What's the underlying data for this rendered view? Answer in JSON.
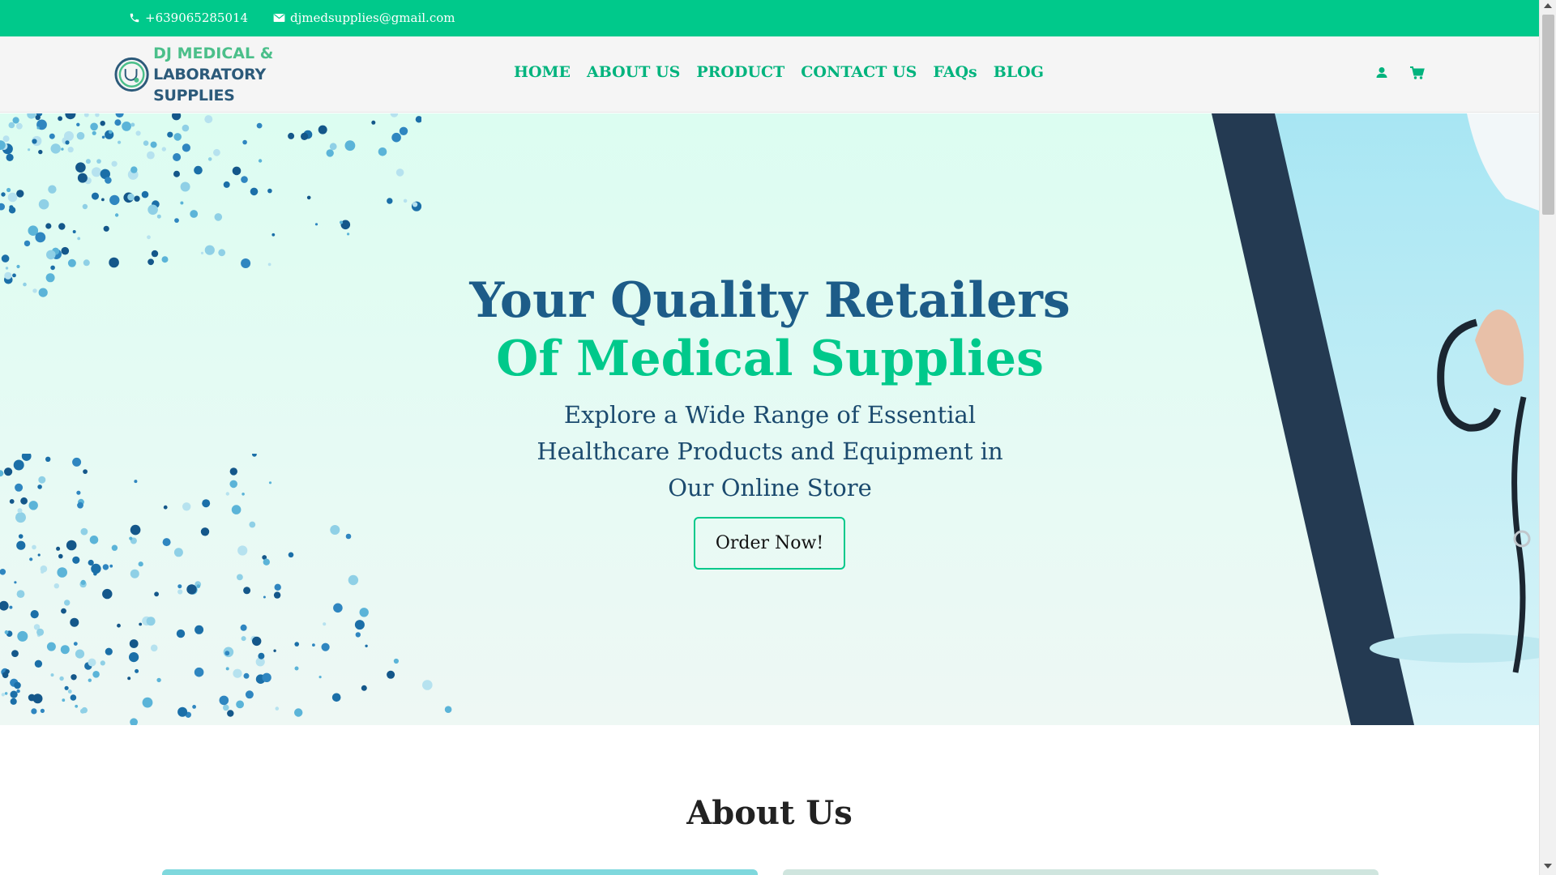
{
  "topbar": {
    "phone": "+639065285014",
    "email": "djmedsupplies@gmail.com",
    "phone_icon": "phone-icon",
    "email_icon": "envelope-icon"
  },
  "header": {
    "logo_line1": "DJ MEDICAL &",
    "logo_line2": "LABORATORY SUPPLIES",
    "nav": [
      "HOME",
      "ABOUT US",
      "PRODUCT",
      "CONTACT US",
      "FAQs",
      "BLOG"
    ],
    "icons": [
      "user-icon",
      "cart-icon"
    ]
  },
  "hero": {
    "title_line1": "Your Quality Retailers",
    "title_line2": "Of Medical Supplies",
    "subtitle": "Explore a Wide Range of Essential Healthcare Products and Equipment in Our Online Store",
    "cta": "Order Now!"
  },
  "about": {
    "title": "About Us"
  },
  "colors": {
    "accent": "#00c98b",
    "brand_dark": "#1d5c88",
    "hero_bg": "#e3fbf2",
    "stripe": "#26394f"
  }
}
